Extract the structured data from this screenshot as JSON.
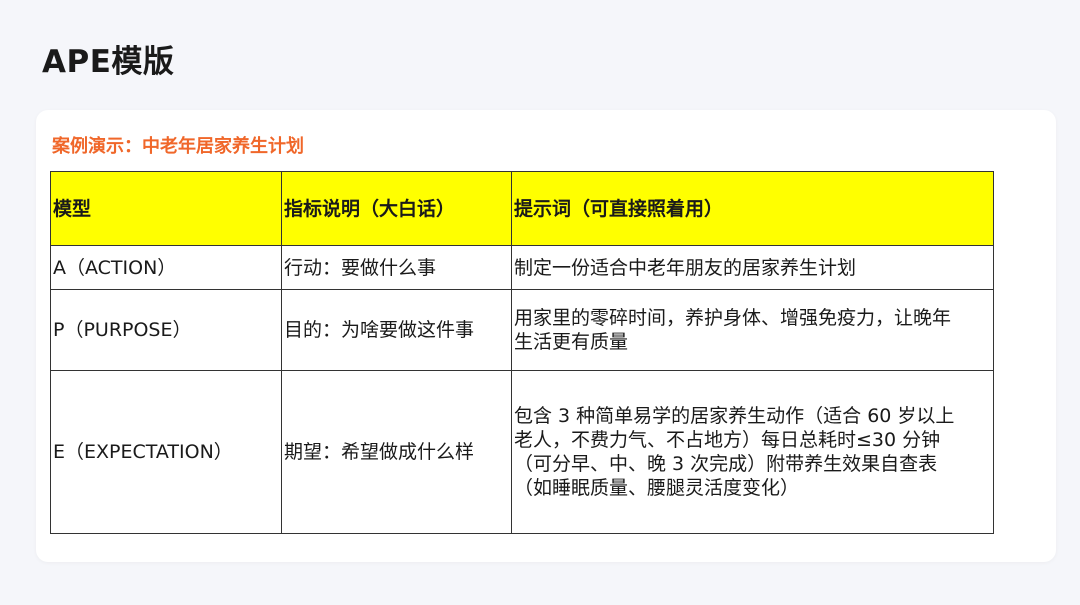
{
  "page": {
    "title": "APE模版"
  },
  "card": {
    "case_title": "案例演示：中老年居家养生计划",
    "accent_color": "#f0672a",
    "header_bg": "#ffff00"
  },
  "table": {
    "headers": [
      "模型",
      "指标说明（大白话）",
      "提示词（可直接照着用）"
    ],
    "rows": [
      {
        "model": "A（ACTION）",
        "explain": "行动：要做什么事",
        "prompt": "制定一份适合中老年朋友的居家养生计划"
      },
      {
        "model": "P（PURPOSE）",
        "explain": "目的：为啥要做这件事",
        "prompt": "用家里的零碎时间，养护身体、增强免疫力，让晚年\n生活更有质量"
      },
      {
        "model": "E（EXPECTATION）",
        "explain": "期望：希望做成什么样",
        "prompt": "包含 3 种简单易学的居家养生动作（适合 60 岁以上\n老人，不费力气、不占地方）每日总耗时≤30 分钟\n（可分早、中、晚 3 次完成）附带养生效果自查表\n（如睡眠质量、腰腿灵活度变化）"
      }
    ]
  }
}
